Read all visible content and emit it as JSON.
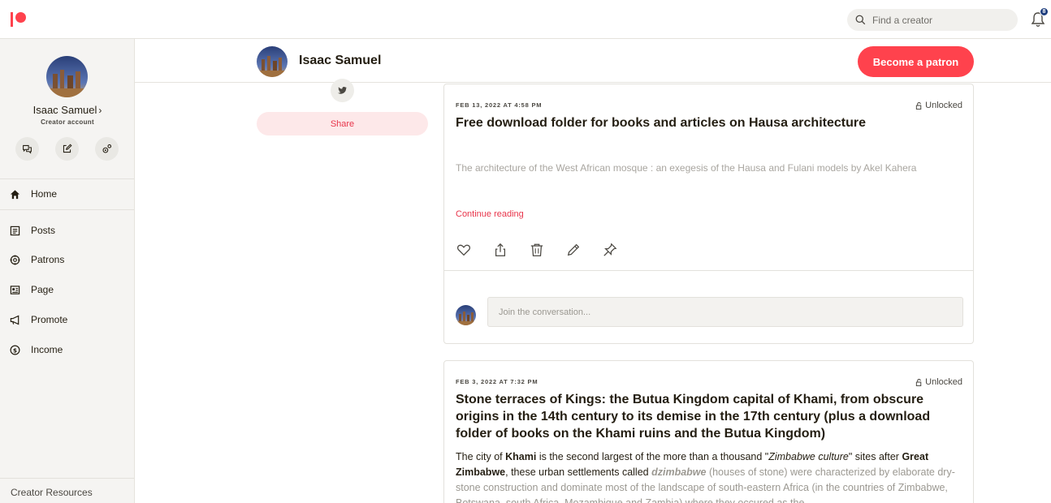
{
  "header": {
    "search_placeholder": "Find a creator",
    "notification_count": "8"
  },
  "sidebar": {
    "user_name": "Isaac Samuel",
    "user_role": "Creator account",
    "nav": [
      {
        "label": "Home"
      },
      {
        "label": "Posts"
      },
      {
        "label": "Patrons"
      },
      {
        "label": "Page"
      },
      {
        "label": "Promote"
      },
      {
        "label": "Income"
      }
    ],
    "footer_link": "Creator Resources"
  },
  "creator": {
    "name": "Isaac Samuel",
    "become_patron_label": "Become a patron",
    "share_label": "Share"
  },
  "posts": [
    {
      "date": "FEB 13, 2022 AT 4:58 PM",
      "lock_status": "Unlocked",
      "title": "Free download folder for books and articles on Hausa architecture",
      "excerpt": "The architecture of the West African mosque : an exegesis of the Hausa and Fulani models by Akel Kahera",
      "continue_label": "Continue reading",
      "comment_placeholder": "Join the conversation..."
    },
    {
      "date": "FEB 3, 2022 AT 7:32 PM",
      "lock_status": "Unlocked",
      "title": "Stone terraces of Kings: the Butua Kingdom capital of Khami, from obscure origins in the 14th century to its demise in the 17th century (plus a download folder of books on the Khami ruins and the Butua Kingdom)",
      "body": {
        "t1": "The city of ",
        "b1": "Khami",
        "t2": " is the second largest of the more than a thousand \"",
        "i1": "Zimbabwe culture",
        "t3": "\" sites after ",
        "b2": "Great Zimbabwe",
        "t4": ", these urban settlements called ",
        "bi1": "dzimbabwe",
        "t5": " (houses of stone) were characterized by elaborate dry-stone construction and dominate most of the landscape of south-eastern Africa (in the countries of Zimbabwe, Botswana, south Africa, Mozambique and Zambia) where they occured as the"
      }
    }
  ],
  "icons": {
    "post_actions": [
      "heart-icon",
      "share-icon",
      "trash-icon",
      "edit-icon",
      "pin-icon"
    ],
    "sidebar_actions": [
      "chat-icon",
      "edit-square-icon",
      "settings-icon"
    ]
  },
  "colors": {
    "brand": "#ff424d",
    "accent_text": "#e8354b",
    "badge": "#1c3c7c"
  }
}
